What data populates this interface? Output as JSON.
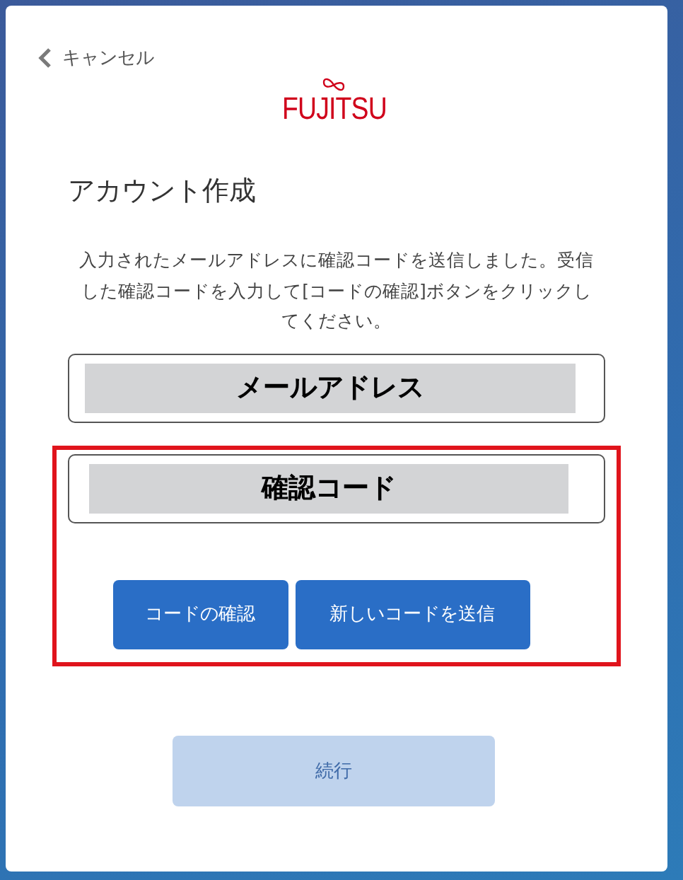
{
  "cancel_link": {
    "label": "キャンセル"
  },
  "logo": {
    "text": "FUJITSU"
  },
  "heading": "アカウント作成",
  "message": "入力されたメールアドレスに確認コードを送信しました。受信した確認コードを入力して[コードの確認]ボタンをクリックしてください。",
  "email_field": {
    "label": "メールアドレス"
  },
  "verification": {
    "highlighted": true,
    "field": {
      "label": "確認コード"
    },
    "buttons": [
      {
        "label": "コードの確認"
      },
      {
        "label": "新しいコードを送信"
      }
    ]
  },
  "continue_button": {
    "label": "続行",
    "disabled": true
  }
}
